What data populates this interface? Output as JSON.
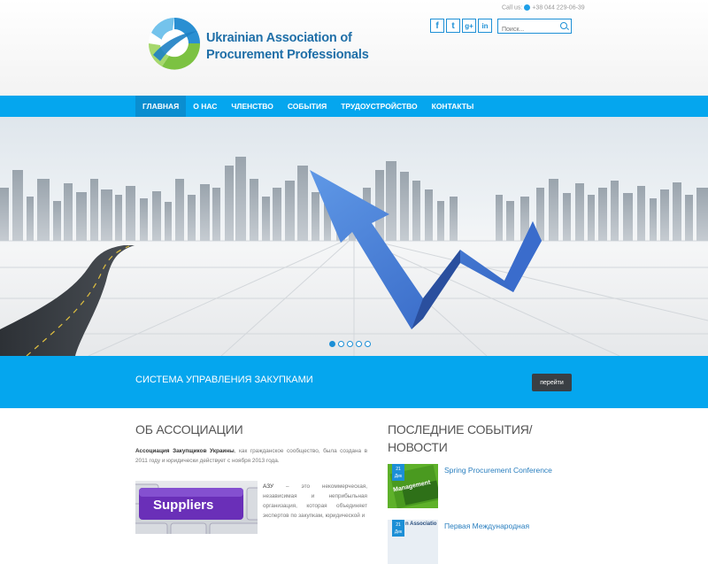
{
  "header": {
    "org_line1": "Ukrainian Association of",
    "org_line2": "Procurement Professionals",
    "contact_label": "Call us:",
    "phone": "+38 044 229-06-39",
    "search_placeholder": "Поиск...",
    "socials": [
      {
        "icon": "facebook-icon",
        "glyph": "f"
      },
      {
        "icon": "twitter-icon",
        "glyph": "t"
      },
      {
        "icon": "googleplus-icon",
        "glyph": "g+"
      },
      {
        "icon": "linkedin-icon",
        "glyph": "in"
      }
    ]
  },
  "nav": {
    "items": [
      "ГЛАВНАЯ",
      "О НАС",
      "ЧЛЕНСТВО",
      "СОБЫТИЯ",
      "ТРУДОУСТРОЙСТВО",
      "КОНТАКТЫ"
    ],
    "active_index": 0
  },
  "slider": {
    "dot_count": 5,
    "active_index": 0
  },
  "banner": {
    "text": "СИСТЕМА УПРАВЛЕНИЯ ЗАКУПКАМИ",
    "button_label": "перейти"
  },
  "about": {
    "title": "ОБ АССОЦИАЦИИ",
    "p1_lead": "Ассоциация Закупщиков Украины",
    "p1_text": ", как гражданское сообщество, была создана в 2011 году и юридически действует с ноября 2013 года.",
    "p2_lead": "АЗУ",
    "p2_text": " – это некоммерческая, независимая и неприбыльная организация, которая объединяет экспертов по закупкам, юридической и",
    "image_word": "Suppliers"
  },
  "news": {
    "title": "ПОСЛЕДНИЕ СОБЫТИЯ/ НОВОСТИ",
    "items": [
      {
        "day": "21",
        "month": "Дек",
        "title": "Spring Procurement Conference",
        "thumb_text": "Management"
      },
      {
        "day": "21",
        "month": "Дек",
        "title": "Первая Международная",
        "thumb_text": "n Associatio"
      }
    ]
  },
  "colors": {
    "primary": "#05a6ee",
    "nav_active": "#0a8ed0",
    "button_dark": "#3a3f44",
    "logo_text": "#1f6fa8",
    "link": "#2a7fbf"
  }
}
